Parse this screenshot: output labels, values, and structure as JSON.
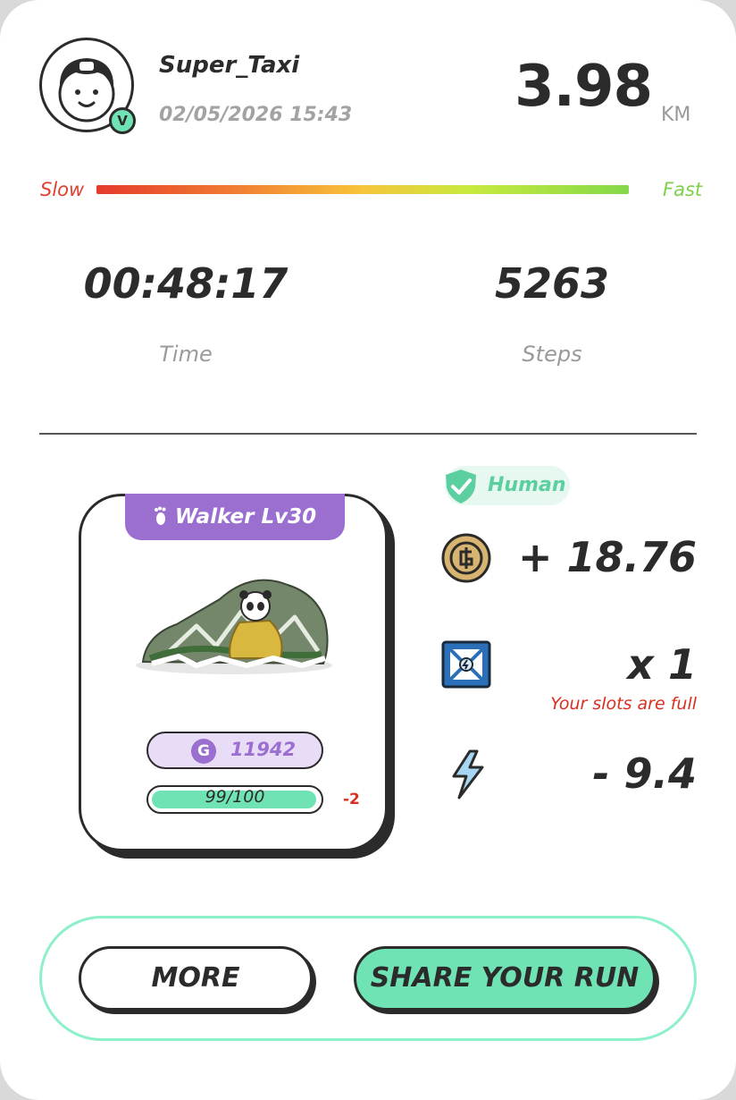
{
  "user": {
    "username": "Super_Taxi",
    "datetime": "02/05/2026 15:43",
    "verified_badge": "V",
    "avatar_icon": "user-avatar-icon"
  },
  "run": {
    "distance": "3.98",
    "distance_unit": "KM",
    "speed_slow_label": "Slow",
    "speed_fast_label": "Fast",
    "time_value": "00:48:17",
    "time_label": "Time",
    "steps_value": "5263",
    "steps_label": "Steps"
  },
  "sneaker": {
    "tab_label": "Walker Lv30",
    "tab_icon": "footprint-icon",
    "gmt_symbol": "G",
    "gmt_value": "11942",
    "durability_text": "99/100",
    "durability_fraction": 0.99,
    "durability_delta": "-2",
    "image_icon": "panda-sneaker-icon"
  },
  "rewards": {
    "verification_label": "Human",
    "verification_icon": "shield-check-icon",
    "gst_icon": "gst-coin-icon",
    "gst_value": "+ 18.76",
    "box_icon": "mystery-box-icon",
    "box_value": "x 1",
    "box_note": "Your slots are full",
    "energy_icon": "lightning-icon",
    "energy_value": "- 9.4"
  },
  "actions": {
    "more_label": "MORE",
    "share_label": "SHARE YOUR RUN"
  },
  "colors": {
    "accent_green": "#6fe3b4",
    "accent_purple": "#9b6fd0",
    "warning_red": "#d83020",
    "text_dark": "#2b2b2b"
  }
}
